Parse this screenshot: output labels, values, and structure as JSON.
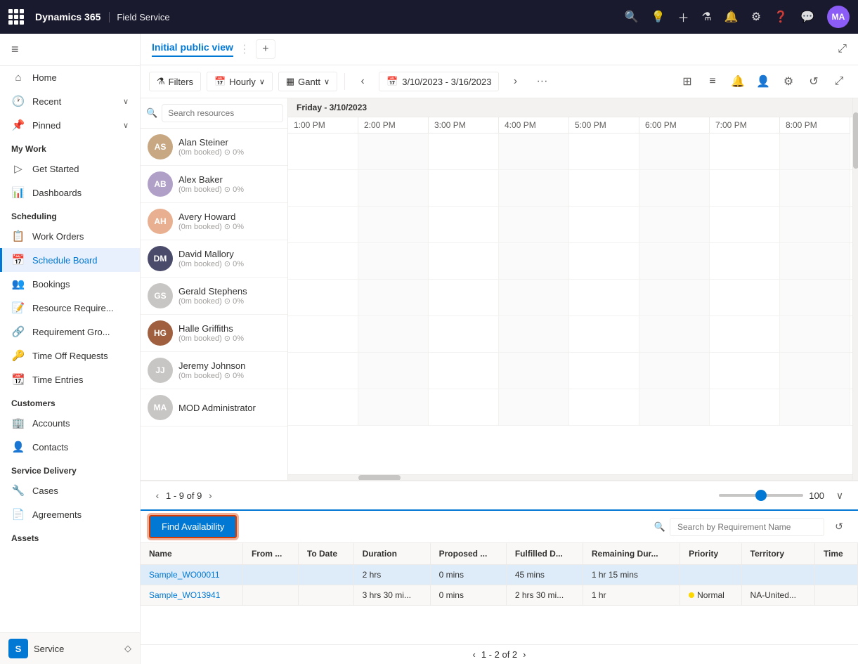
{
  "topNav": {
    "brand": "Dynamics 365",
    "appName": "Field Service",
    "avatarInitials": "MA",
    "avatarColor": "#8b5cf6"
  },
  "sidebar": {
    "toggleIcon": "≡",
    "navItems": [
      {
        "id": "home",
        "icon": "⌂",
        "label": "Home",
        "active": false
      },
      {
        "id": "recent",
        "icon": "🕐",
        "label": "Recent",
        "active": false,
        "hasChevron": true
      },
      {
        "id": "pinned",
        "icon": "📌",
        "label": "Pinned",
        "active": false,
        "hasChevron": true
      }
    ],
    "groups": [
      {
        "label": "My Work",
        "items": [
          {
            "id": "get-started",
            "icon": "▷",
            "label": "Get Started"
          },
          {
            "id": "dashboards",
            "icon": "📊",
            "label": "Dashboards"
          }
        ]
      },
      {
        "label": "Scheduling",
        "items": [
          {
            "id": "work-orders",
            "icon": "📋",
            "label": "Work Orders"
          },
          {
            "id": "schedule-board",
            "icon": "📅",
            "label": "Schedule Board",
            "active": true
          },
          {
            "id": "bookings",
            "icon": "👥",
            "label": "Bookings"
          },
          {
            "id": "resource-requirements",
            "icon": "📝",
            "label": "Resource Require..."
          },
          {
            "id": "requirement-groups",
            "icon": "🔗",
            "label": "Requirement Gro..."
          },
          {
            "id": "time-off-requests",
            "icon": "🔑",
            "label": "Time Off Requests"
          },
          {
            "id": "time-entries",
            "icon": "📆",
            "label": "Time Entries"
          }
        ]
      },
      {
        "label": "Customers",
        "items": [
          {
            "id": "accounts",
            "icon": "🏢",
            "label": "Accounts"
          },
          {
            "id": "contacts",
            "icon": "👤",
            "label": "Contacts"
          }
        ]
      },
      {
        "label": "Service Delivery",
        "items": [
          {
            "id": "cases",
            "icon": "🔧",
            "label": "Cases"
          },
          {
            "id": "agreements",
            "icon": "📄",
            "label": "Agreements"
          }
        ]
      },
      {
        "label": "Assets",
        "items": []
      }
    ]
  },
  "viewHeader": {
    "tabLabel": "Initial public view",
    "addIcon": "+"
  },
  "toolbar": {
    "filtersLabel": "Filters",
    "hourlyLabel": "Hourly",
    "ganttLabel": "Gantt",
    "dateRange": "3/10/2023 - 3/16/2023",
    "moreIcon": "···",
    "zoomValue": "100"
  },
  "scheduleBoard": {
    "dayLabel": "Friday - 3/10/2023",
    "timeSlots": [
      "1:00 PM",
      "2:00 PM",
      "3:00 PM",
      "4:00 PM",
      "5:00 PM",
      "6:00 PM",
      "7:00 PM",
      "8:00 PM"
    ],
    "resources": [
      {
        "id": "alan-steiner",
        "name": "Alan Steiner",
        "meta": "(0m booked) ⊙ 0%",
        "avatarColor": "#c8a882"
      },
      {
        "id": "alex-baker",
        "name": "Alex Baker",
        "meta": "(0m booked) ⊙ 0%",
        "avatarColor": "#b0a0c8"
      },
      {
        "id": "avery-howard",
        "name": "Avery Howard",
        "meta": "(0m booked) ⊙ 0%",
        "avatarColor": "#e8b090"
      },
      {
        "id": "david-mallory",
        "name": "David Mallory",
        "meta": "(0m booked) ⊙ 0%",
        "avatarColor": "#4a4a6a"
      },
      {
        "id": "gerald-stephens",
        "name": "Gerald Stephens",
        "meta": "(0m booked) ⊙ 0%",
        "avatarColor": "#c8c6c4"
      },
      {
        "id": "halle-griffiths",
        "name": "Halle Griffiths",
        "meta": "(0m booked) ⊙ 0%",
        "avatarColor": "#a06040"
      },
      {
        "id": "jeremy-johnson",
        "name": "Jeremy Johnson",
        "meta": "(0m booked) ⊙ 0%",
        "avatarColor": "#c8c6c4"
      },
      {
        "id": "mod-admin",
        "name": "MOD Administrator",
        "meta": "",
        "avatarColor": "#c8c6c4"
      }
    ],
    "pagination": {
      "current": "1 - 9 of 9"
    },
    "zoomLevel": "100"
  },
  "bottomPanel": {
    "findAvailabilityLabel": "Find Availability",
    "searchPlaceholder": "Search by Requirement Name",
    "columns": [
      "Name",
      "From ...",
      "To Date",
      "Duration",
      "Proposed ...",
      "Fulfilled D...",
      "Remaining Dur...",
      "Priority",
      "Territory",
      "Time"
    ],
    "rows": [
      {
        "id": "row1",
        "name": "Sample_WO00011",
        "fromDate": "",
        "toDate": "",
        "duration": "2 hrs",
        "proposed": "0 mins",
        "fulfilled": "45 mins",
        "remaining": "1 hr 15 mins",
        "priority": "",
        "priorityColor": "",
        "territory": "",
        "time": "",
        "selected": true
      },
      {
        "id": "row2",
        "name": "Sample_WO13941",
        "fromDate": "",
        "toDate": "",
        "duration": "3 hrs 30 mi...",
        "proposed": "0 mins",
        "fulfilled": "2 hrs 30 mi...",
        "remaining": "1 hr",
        "priority": "Normal",
        "priorityColor": "#ffd700",
        "territory": "NA-United...",
        "time": "",
        "selected": false
      }
    ],
    "pagination": {
      "current": "1 - 2 of 2"
    }
  },
  "bottomStatusBar": {
    "appLabel": "Service",
    "appIcon": "S"
  }
}
